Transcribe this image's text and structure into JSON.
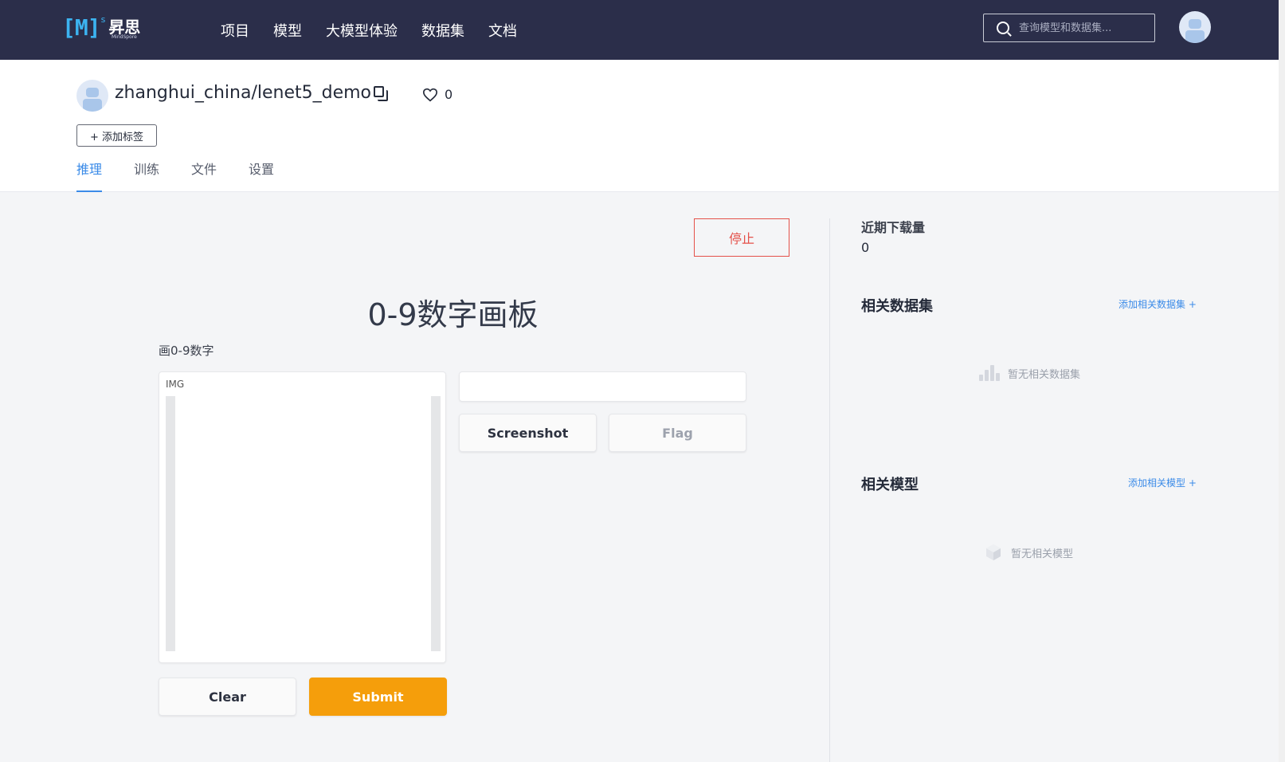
{
  "topnav": {
    "logo_mark": "[M]",
    "logo_sup": "s",
    "logo_text": "昇思",
    "logo_sub": "MindSpore",
    "items": [
      "项目",
      "模型",
      "大模型体验",
      "数据集",
      "文档"
    ],
    "search_placeholder": "查询模型和数据集..."
  },
  "repo": {
    "title": "zhanghui_china/lenet5_demo",
    "likes": "0",
    "add_tag_label": "+ 添加标签",
    "tabs": [
      "推理",
      "训练",
      "文件",
      "设置"
    ],
    "active_tab": "推理"
  },
  "inference": {
    "stop_label": "停止",
    "title": "0-9数字画板",
    "description": "画0-9数字",
    "img_label": "IMG",
    "screenshot_label": "Screenshot",
    "flag_label": "Flag",
    "clear_label": "Clear",
    "submit_label": "Submit"
  },
  "sidebar": {
    "downloads_label": "近期下载量",
    "downloads_value": "0",
    "datasets_title": "相关数据集",
    "datasets_add": "添加相关数据集 +",
    "datasets_empty": "暂无相关数据集",
    "models_title": "相关模型",
    "models_add": "添加相关模型 +",
    "models_empty": "暂无相关模型"
  },
  "colors": {
    "nav_bg": "#2b2e4a",
    "accent": "#3b8be8",
    "stop": "#e4514a",
    "submit": "#f59e0b"
  }
}
